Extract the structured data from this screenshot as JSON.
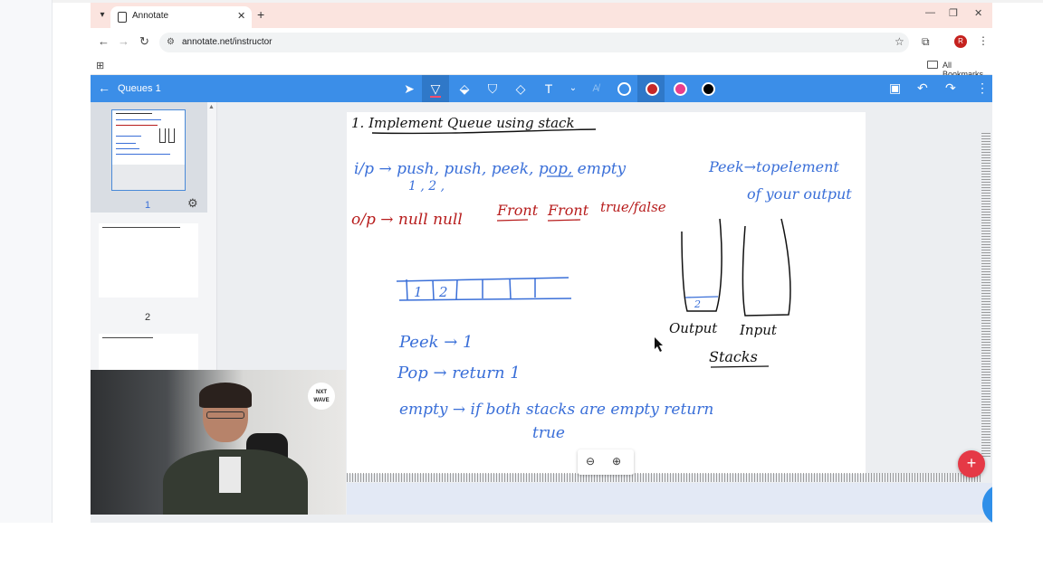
{
  "browser": {
    "tab_title": "Annotate",
    "url": "annotate.net/instructor",
    "bookmarks_label": "All Bookmarks",
    "avatar_initial": "R"
  },
  "app": {
    "title": "Queues 1",
    "colors": {
      "header": "#3b8ee8",
      "accent_red": "#c62828",
      "accent_pink": "#e83e8c",
      "ink_blue": "#3a6fd8",
      "ink_red": "#b71c1c"
    },
    "tools": [
      "pointer-icon",
      "pen-icon",
      "marker-icon",
      "highlighter-icon",
      "eraser-icon",
      "text-icon",
      "chevron-down-icon",
      "font-size-icon"
    ],
    "swatches": [
      "#ffffff",
      "#c62828",
      "#e83e8c",
      "#000000"
    ]
  },
  "thumbnails": [
    {
      "page": "1"
    },
    {
      "page": "2"
    }
  ],
  "notes": {
    "title": "1. Implement Queue using stack",
    "ip_line": "i/p → push, push, peek, pop, empty",
    "ip_args": "1 , 2 ,",
    "op_line": "o/p → null null",
    "op_front1": "Front",
    "op_front2": "Front",
    "op_tf": "true/false",
    "peek_note_1": "Peek→topelement",
    "peek_note_2": "of your output",
    "arr_1": "1",
    "arr_2": "2",
    "stack_item": "2",
    "label_output": "Output",
    "label_input": "Input",
    "label_stacks": "Stacks",
    "peek_line": "Peek → 1",
    "pop_line": "Pop → return 1",
    "empty_line_1": "empty → if both stacks are empty return",
    "empty_line_2": "true"
  },
  "webcam": {
    "logo_text": "NXT WAVE"
  }
}
